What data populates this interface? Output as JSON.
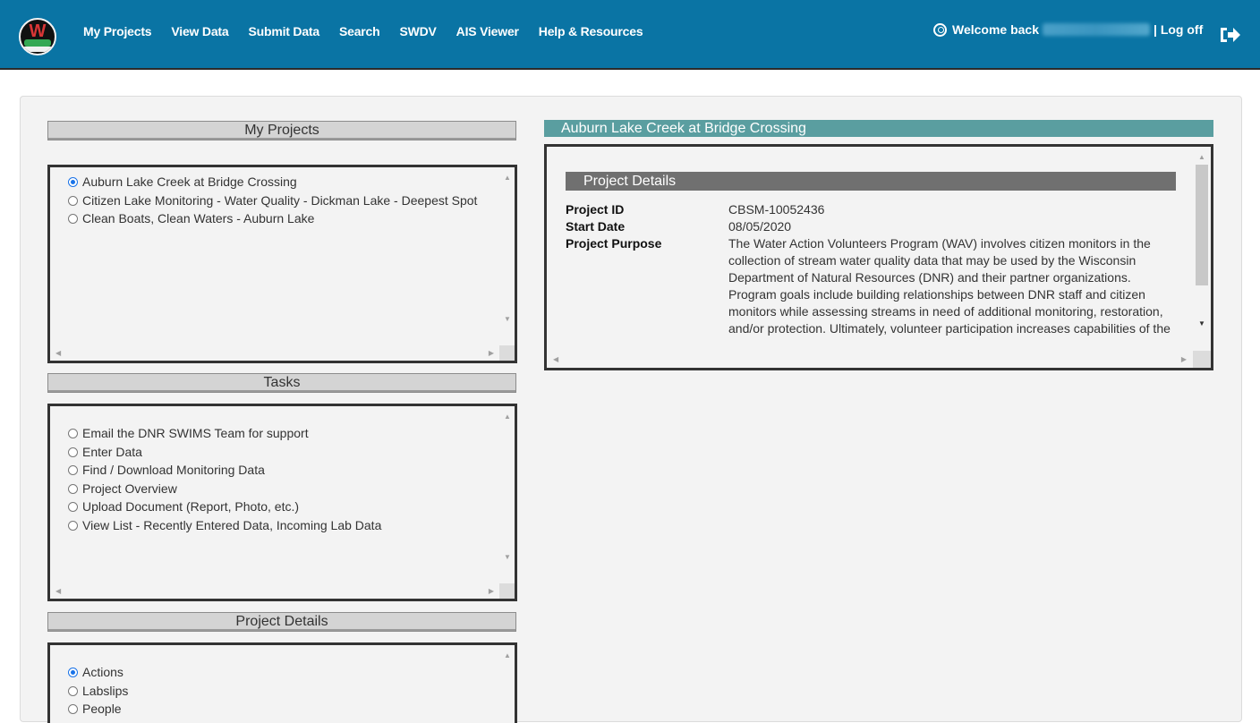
{
  "header": {
    "nav": [
      "My Projects",
      "View Data",
      "Submit Data",
      "Search",
      "SWDV",
      "AIS Viewer",
      "Help & Resources"
    ],
    "welcome_label": "Welcome back",
    "logoff_label": "| Log off",
    "brand_color": "#0a74a4"
  },
  "my_projects": {
    "title": "My Projects",
    "items": [
      {
        "label": "Auburn Lake Creek at Bridge Crossing",
        "selected": true
      },
      {
        "label": "Citizen Lake Monitoring - Water Quality - Dickman Lake - Deepest Spot",
        "selected": false
      },
      {
        "label": "Clean Boats, Clean Waters - Auburn Lake",
        "selected": false
      }
    ]
  },
  "tasks": {
    "title": "Tasks",
    "items": [
      {
        "label": "Email the DNR SWIMS Team for support",
        "selected": false
      },
      {
        "label": "Enter Data",
        "selected": false
      },
      {
        "label": "Find / Download Monitoring Data",
        "selected": false
      },
      {
        "label": "Project Overview",
        "selected": false
      },
      {
        "label": "Upload Document (Report, Photo, etc.)",
        "selected": false
      },
      {
        "label": "View List - Recently Entered Data, Incoming Lab Data",
        "selected": false
      }
    ]
  },
  "project_details_list": {
    "title": "Project Details",
    "items": [
      {
        "label": "Actions",
        "selected": true
      },
      {
        "label": "Labslips",
        "selected": false
      },
      {
        "label": "People",
        "selected": false
      }
    ]
  },
  "detail": {
    "project_title": "Auburn Lake Creek at Bridge Crossing",
    "section_title": "Project Details",
    "project_id_label": "Project ID",
    "project_id": "CBSM-10052436",
    "start_date_label": "Start Date",
    "start_date": "08/05/2020",
    "purpose_label": "Project Purpose",
    "purpose": "The Water Action Volunteers Program (WAV) involves citizen monitors in the collection of stream water quality data that may be used by the Wisconsin Department of Natural Resources (DNR) and their partner organizations. Program goals include building relationships between DNR staff and citizen monitors while assessing streams in need of additional monitoring, restoration, and/or protection. Ultimately, volunteer participation increases capabilities of the"
  }
}
